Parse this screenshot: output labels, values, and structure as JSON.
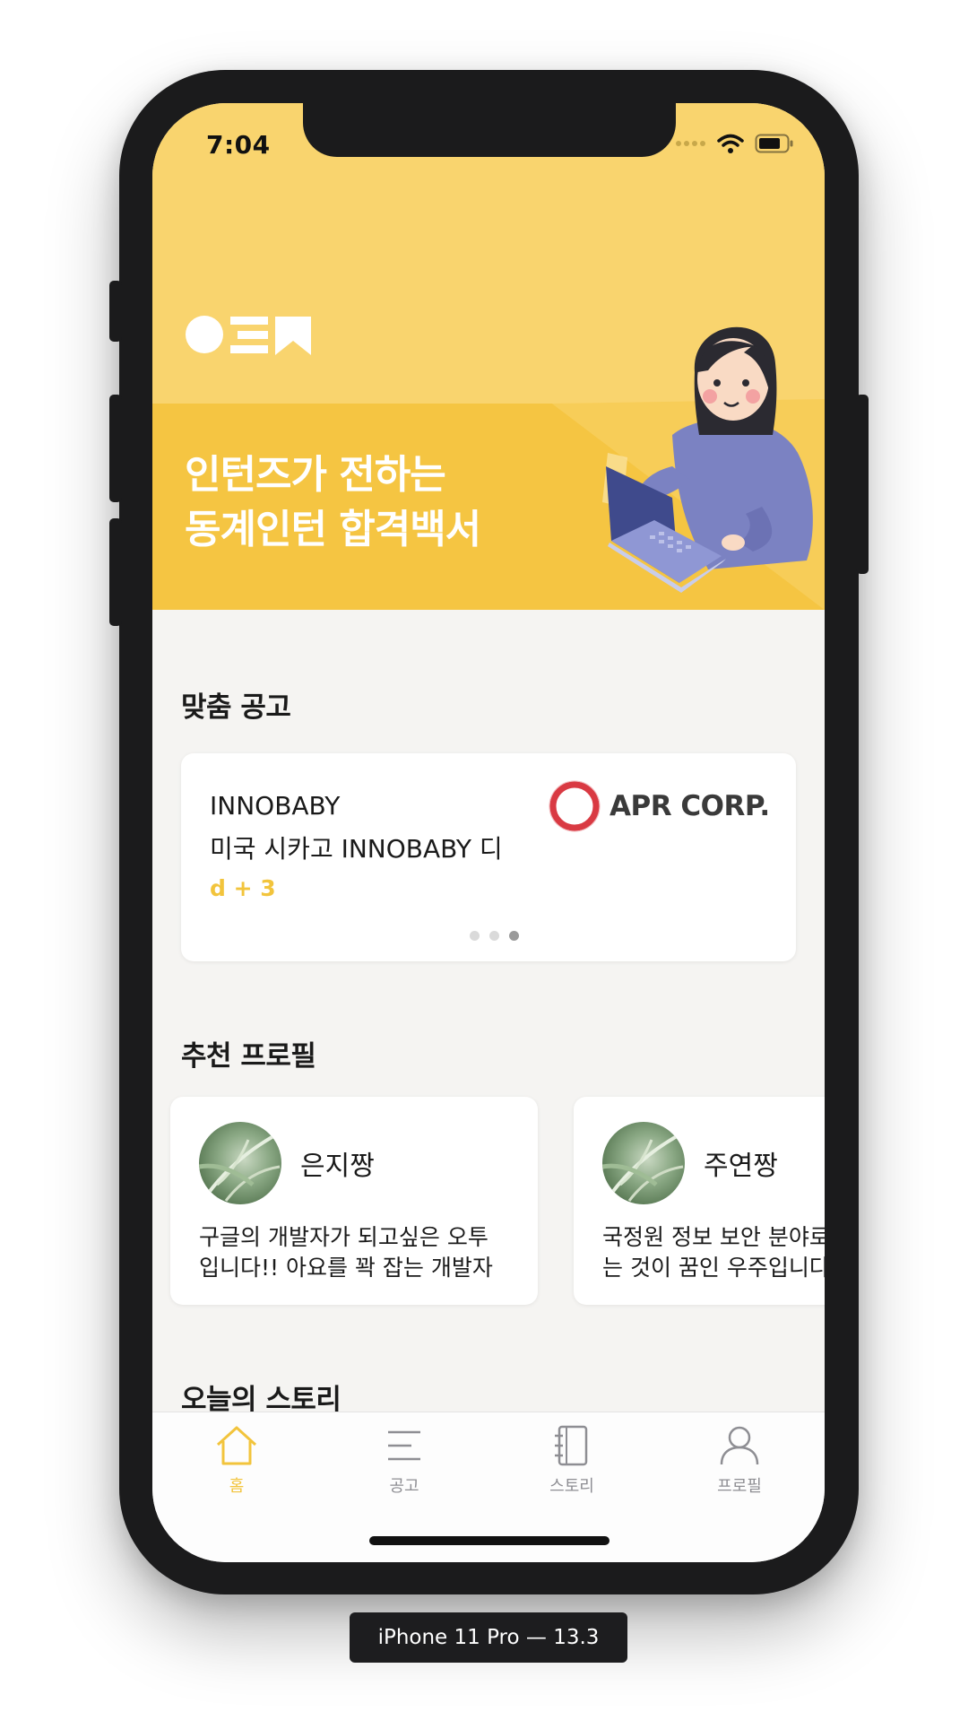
{
  "device_label": "iPhone 11 Pro — 13.3",
  "status_bar": {
    "time": "7:04"
  },
  "banner": {
    "title_line1": "인턴즈가 전하는",
    "title_line2": "동계인턴 합격백서",
    "background_color": "#f9d46e"
  },
  "recommended_jobs": {
    "title": "맞춤 공고",
    "card": {
      "company": "INNOBABY",
      "description": "미국 시카고 INNOBABY 디",
      "dday": "d + 3",
      "logo_text": "APR CORP."
    },
    "pagination": {
      "total": 3,
      "active_index": 3
    }
  },
  "recommended_profiles": {
    "title": "추천 프로필",
    "items": [
      {
        "name": "은지짱",
        "bio_line1": "구글의 개발자가 되고싶은 오투",
        "bio_line2": "입니다!! 아요를 꽉 잡는 개발자"
      },
      {
        "name": "주연짱",
        "bio_line1": "국정원 정보 보안 분야로",
        "bio_line2": "는 것이 꿈인 우주입니다"
      }
    ]
  },
  "todays_story": {
    "title": "오늘의 스토리"
  },
  "tab_bar": {
    "items": [
      {
        "label": "홈",
        "icon": "home-icon",
        "active": true
      },
      {
        "label": "공고",
        "icon": "list-icon",
        "active": false
      },
      {
        "label": "스토리",
        "icon": "notebook-icon",
        "active": false
      },
      {
        "label": "프로필",
        "icon": "person-icon",
        "active": false
      }
    ],
    "active_color": "#f2c43c",
    "inactive_color": "#8e8e93"
  }
}
